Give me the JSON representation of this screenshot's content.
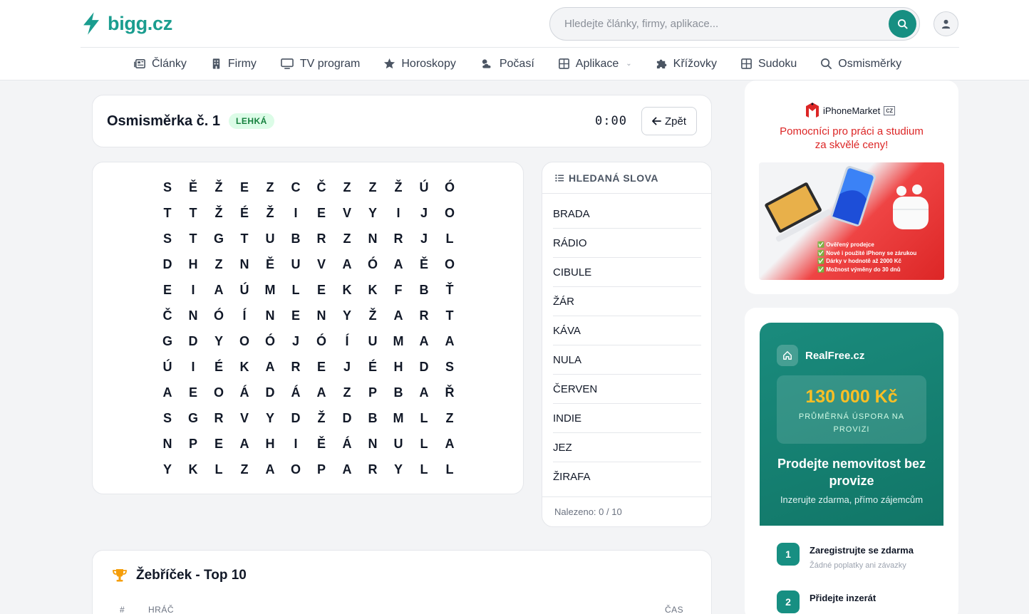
{
  "header": {
    "logo_text": "bigg.cz",
    "search_placeholder": "Hledejte články, firmy, aplikace...",
    "nav": [
      {
        "label": "Články",
        "icon": "newspaper-icon"
      },
      {
        "label": "Firmy",
        "icon": "building-icon"
      },
      {
        "label": "TV program",
        "icon": "tv-icon"
      },
      {
        "label": "Horoskopy",
        "icon": "star-icon"
      },
      {
        "label": "Počasí",
        "icon": "cloud-sun-icon"
      },
      {
        "label": "Aplikace",
        "icon": "grid-icon"
      },
      {
        "label": "Křížovky",
        "icon": "puzzle-icon"
      },
      {
        "label": "Sudoku",
        "icon": "grid-icon"
      },
      {
        "label": "Osmisměrky",
        "icon": "search-icon"
      }
    ]
  },
  "puzzle": {
    "title": "Osmisměrka č. 1",
    "difficulty": "LEHKÁ",
    "timer": "0:00",
    "back_label": "Zpět",
    "grid": [
      [
        "S",
        "Ě",
        "Ž",
        "E",
        "Z",
        "C",
        "Č",
        "Z",
        "Z",
        "Ž",
        "Ú",
        "Ó"
      ],
      [
        "T",
        "T",
        "Ž",
        "É",
        "Ž",
        "I",
        "E",
        "V",
        "Y",
        "I",
        "J",
        "O"
      ],
      [
        "S",
        "T",
        "G",
        "T",
        "U",
        "B",
        "R",
        "Z",
        "N",
        "R",
        "J",
        "L"
      ],
      [
        "D",
        "H",
        "Z",
        "N",
        "Ě",
        "U",
        "V",
        "A",
        "Ó",
        "A",
        "Ě",
        "O"
      ],
      [
        "E",
        "I",
        "A",
        "Ú",
        "M",
        "L",
        "E",
        "K",
        "K",
        "F",
        "B",
        "Ť"
      ],
      [
        "Č",
        "N",
        "Ó",
        "Í",
        "N",
        "E",
        "N",
        "Y",
        "Ž",
        "A",
        "R",
        "T"
      ],
      [
        "G",
        "D",
        "Y",
        "O",
        "Ó",
        "J",
        "Ó",
        "Í",
        "U",
        "M",
        "A",
        "A"
      ],
      [
        "Ú",
        "I",
        "É",
        "K",
        "A",
        "R",
        "E",
        "J",
        "É",
        "H",
        "D",
        "S"
      ],
      [
        "A",
        "E",
        "O",
        "Á",
        "D",
        "Á",
        "A",
        "Z",
        "P",
        "B",
        "A",
        "Ř"
      ],
      [
        "S",
        "G",
        "R",
        "V",
        "Y",
        "D",
        "Ž",
        "D",
        "B",
        "M",
        "L",
        "Z"
      ],
      [
        "N",
        "P",
        "E",
        "A",
        "H",
        "I",
        "Ě",
        "Á",
        "N",
        "U",
        "L",
        "A"
      ],
      [
        "Y",
        "K",
        "L",
        "Z",
        "A",
        "O",
        "P",
        "A",
        "R",
        "Y",
        "L",
        "L"
      ]
    ]
  },
  "words": {
    "heading": "HLEDANÁ SLOVA",
    "items": [
      "BRADA",
      "RÁDIO",
      "CIBULE",
      "ŽÁR",
      "KÁVA",
      "NULA",
      "ČERVEN",
      "INDIE",
      "JEZ",
      "ŽIRAFA"
    ],
    "found_text": "Nalezeno: 0 / 10"
  },
  "leaderboard": {
    "title": "Žebříček - Top 10",
    "col_rank": "#",
    "col_player": "HRÁČ",
    "col_time": "ČAS"
  },
  "ad1": {
    "brand": "iPhoneMarket",
    "brand_suffix": "cz",
    "headline_1": "Pomocníci pro práci a studium",
    "headline_2": "za skvělé ceny!",
    "bullets": [
      "Ověřený prodejce",
      "Nové i použité iPhony se zárukou",
      "Dárky v hodnotě až 2000 Kč",
      "Možnost výměny do 30 dnů"
    ]
  },
  "ad2": {
    "brand": "RealFree.cz",
    "price": "130 000 Kč",
    "price_sub": "PRŮMĚRNÁ ÚSPORA NA PROVIZI",
    "heading": "Prodejte nemovitost bez provize",
    "sub": "Inzerujte zdarma, přímo zájemcům",
    "steps": [
      {
        "num": "1",
        "title": "Zaregistrujte se zdarma",
        "sub": "Žádné poplatky ani závazky"
      },
      {
        "num": "2",
        "title": "Přidejte inzerát",
        "sub": ""
      }
    ]
  },
  "colors": {
    "brand": "#1a9d8f",
    "button": "#178f82",
    "badge_bg": "#dcfce7",
    "badge_text": "#15803d",
    "ad_red": "#dc2626"
  }
}
